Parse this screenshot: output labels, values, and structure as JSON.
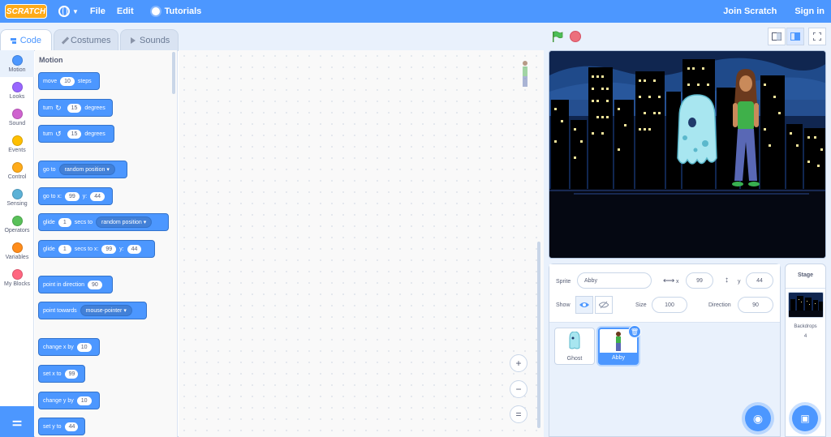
{
  "menubar": {
    "logo": "SCRATCH",
    "file": "File",
    "edit": "Edit",
    "tutorials": "Tutorials",
    "join": "Join Scratch",
    "signin": "Sign in"
  },
  "tabs": {
    "code": "Code",
    "costumes": "Costumes",
    "sounds": "Sounds"
  },
  "categories": [
    {
      "label": "Motion",
      "color": "#4c97ff"
    },
    {
      "label": "Looks",
      "color": "#9966ff"
    },
    {
      "label": "Sound",
      "color": "#cf63cf"
    },
    {
      "label": "Events",
      "color": "#ffbf00"
    },
    {
      "label": "Control",
      "color": "#ffab19"
    },
    {
      "label": "Sensing",
      "color": "#5cb1d6"
    },
    {
      "label": "Operators",
      "color": "#59c059"
    },
    {
      "label": "Variables",
      "color": "#ff8c1a"
    },
    {
      "label": "My Blocks",
      "color": "#ff6680"
    }
  ],
  "palette": {
    "heading": "Motion",
    "move": {
      "a": "move",
      "v": "10",
      "b": "steps"
    },
    "turn_right": {
      "a": "turn",
      "v": "15",
      "b": "degrees"
    },
    "turn_left": {
      "a": "turn",
      "v": "15",
      "b": "degrees"
    },
    "goto": {
      "a": "go to",
      "dd": "random position"
    },
    "goto_xy": {
      "a": "go to x:",
      "x": "99",
      "b": "y:",
      "y": "44"
    },
    "glide": {
      "a": "glide",
      "v": "1",
      "b": "secs to",
      "dd": "random position"
    },
    "glide_xy": {
      "a": "glide",
      "v": "1",
      "b": "secs to x:",
      "x": "99",
      "c": "y:",
      "y": "44"
    },
    "point_dir": {
      "a": "point in direction",
      "v": "90"
    },
    "point_towards": {
      "a": "point towards",
      "dd": "mouse-pointer"
    },
    "change_x": {
      "a": "change x by",
      "v": "10"
    },
    "set_x": {
      "a": "set x to",
      "v": "99"
    },
    "change_y": {
      "a": "change y by",
      "v": "10"
    },
    "set_y": {
      "a": "set y to",
      "v": "44"
    }
  },
  "zoom": {
    "in": "+",
    "out": "−",
    "reset": "="
  },
  "sprite_info": {
    "sprite_label": "Sprite",
    "sprite_name": "Abby",
    "x_label": "x",
    "x": "99",
    "y_label": "y",
    "y": "44",
    "show_label": "Show",
    "size_label": "Size",
    "size": "100",
    "direction_label": "Direction",
    "direction": "90"
  },
  "sprites": [
    {
      "name": "Ghost"
    },
    {
      "name": "Abby"
    }
  ],
  "stage_panel": {
    "title": "Stage",
    "backdrops_label": "Backdrops",
    "backdrops_count": "4"
  }
}
